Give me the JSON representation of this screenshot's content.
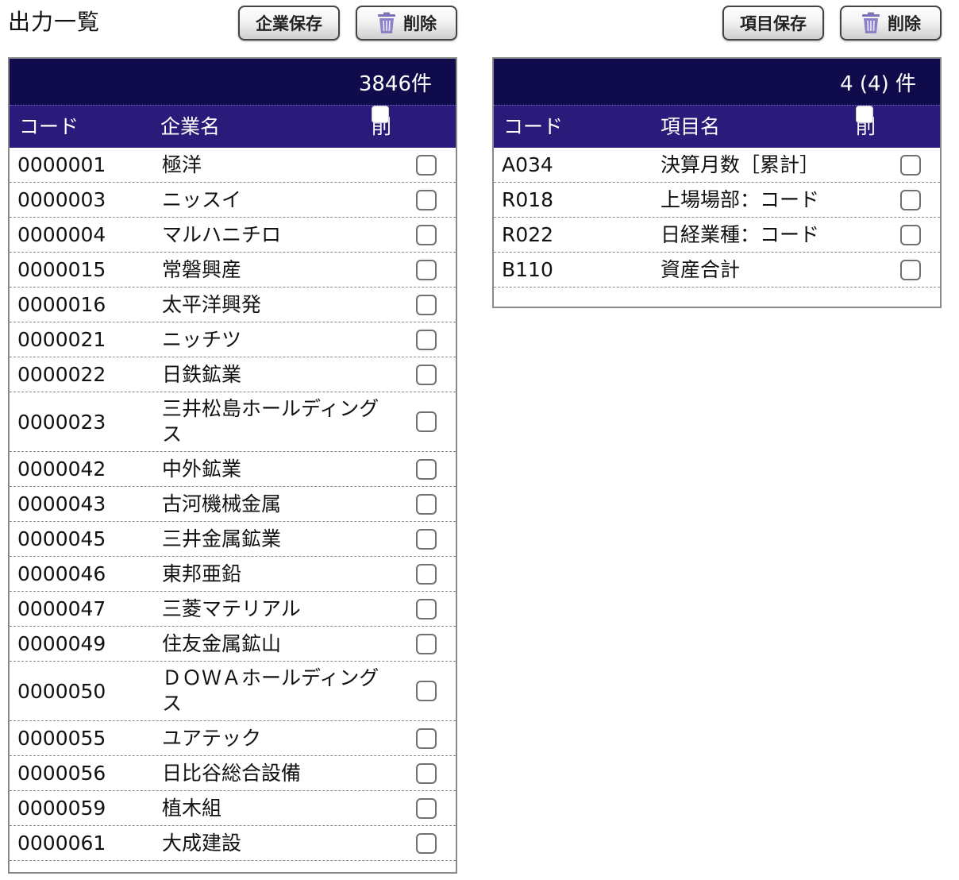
{
  "page": {
    "title": "出力一覧"
  },
  "toolbar_left": {
    "save_label": "企業保存",
    "delete_label": "削除"
  },
  "toolbar_right": {
    "save_label": "項目保存",
    "delete_label": "削除"
  },
  "companies": {
    "count": "3846件",
    "headers": {
      "code": "コード",
      "name": "企業名",
      "delete": "削除"
    },
    "rows": [
      {
        "code": "0000001",
        "name": "極洋"
      },
      {
        "code": "0000003",
        "name": "ニッスイ"
      },
      {
        "code": "0000004",
        "name": "マルハニチロ"
      },
      {
        "code": "0000015",
        "name": "常磐興産"
      },
      {
        "code": "0000016",
        "name": "太平洋興発"
      },
      {
        "code": "0000021",
        "name": "ニッチツ"
      },
      {
        "code": "0000022",
        "name": "日鉄鉱業"
      },
      {
        "code": "0000023",
        "name": "三井松島ホールディングス"
      },
      {
        "code": "0000042",
        "name": "中外鉱業"
      },
      {
        "code": "0000043",
        "name": "古河機械金属"
      },
      {
        "code": "0000045",
        "name": "三井金属鉱業"
      },
      {
        "code": "0000046",
        "name": "東邦亜鉛"
      },
      {
        "code": "0000047",
        "name": "三菱マテリアル"
      },
      {
        "code": "0000049",
        "name": "住友金属鉱山"
      },
      {
        "code": "0000050",
        "name": "ＤＯＷＡホールディングス"
      },
      {
        "code": "0000055",
        "name": "ユアテック"
      },
      {
        "code": "0000056",
        "name": "日比谷総合設備"
      },
      {
        "code": "0000059",
        "name": "植木組"
      },
      {
        "code": "0000061",
        "name": "大成建設"
      }
    ]
  },
  "items": {
    "count": "4 (4) 件",
    "headers": {
      "code": "コード",
      "name": "項目名",
      "delete": "削除"
    },
    "rows": [
      {
        "code": "A034",
        "name": "決算月数［累計］"
      },
      {
        "code": "R018",
        "name": "上場場部：コード"
      },
      {
        "code": "R022",
        "name": "日経業種：コード"
      },
      {
        "code": "B110",
        "name": "資産合計"
      }
    ]
  },
  "icons": {
    "delete": "trash-icon"
  },
  "colors": {
    "header_dark": "#100c4c",
    "header_purple": "#2a1a7a",
    "trash": "#7b72b8"
  }
}
